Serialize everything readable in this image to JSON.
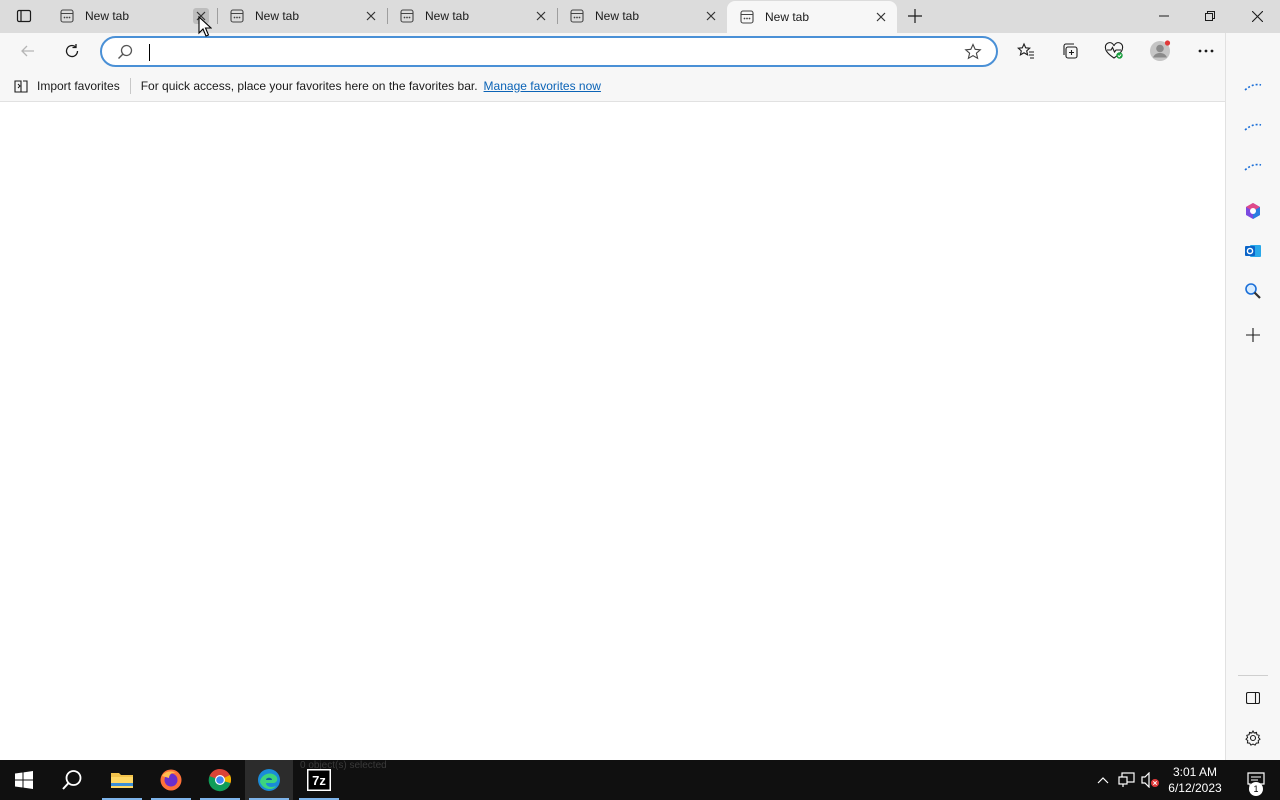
{
  "tabs": [
    {
      "title": "New tab",
      "active": false
    },
    {
      "title": "New tab",
      "active": false
    },
    {
      "title": "New tab",
      "active": false
    },
    {
      "title": "New tab",
      "active": false
    },
    {
      "title": "New tab",
      "active": true
    }
  ],
  "window_controls": [
    "minimize-icon",
    "restore-icon",
    "close-icon"
  ],
  "address_bar": {
    "value": "",
    "placeholder": ""
  },
  "favorites_bar": {
    "import_label": "Import favorites",
    "message": "For quick access, place your favorites here on the favorites bar.",
    "link": "Manage favorites now"
  },
  "toolbar_icons": [
    "back-icon",
    "refresh-icon",
    "favorites-icon",
    "collections-icon",
    "browser-essentials-icon",
    "profile-icon",
    "more-icon",
    "bing-icon"
  ],
  "sidebar_icons": [
    "loading-icon",
    "loading-icon",
    "loading-icon",
    "office-icon",
    "outlook-icon",
    "search-icon",
    "add-icon",
    "hide-sidebar-icon",
    "settings-icon"
  ],
  "taskbar": {
    "apps": [
      "start-icon",
      "search-icon",
      "file-explorer-icon",
      "firefox-icon",
      "chrome-icon",
      "edge-icon",
      "7zip-icon"
    ],
    "ghost_text": "0 object(s) selected",
    "time": "3:01 AM",
    "date": "6/12/2023",
    "notification_count": "1"
  },
  "colors": {
    "accent": "#0b63b6",
    "address_border": "#4a90d6",
    "taskbar": "#101010"
  }
}
